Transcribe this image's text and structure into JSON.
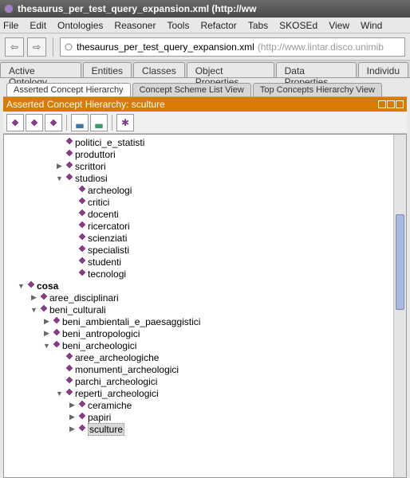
{
  "title": "thesaurus_per_test_query_expansion.xml (http://ww",
  "menu": [
    "File",
    "Edit",
    "Ontologies",
    "Reasoner",
    "Tools",
    "Refactor",
    "Tabs",
    "SKOSEd",
    "View",
    "Wind"
  ],
  "url": {
    "name": "thesaurus_per_test_query_expansion.xml",
    "dim": "(http://www.lintar.disco.unimib"
  },
  "tabs1": [
    "Active Ontology",
    "Entities",
    "Classes",
    "Object Properties",
    "Data Properties",
    "Individu"
  ],
  "tabs2": [
    "Asserted Concept Hierarchy",
    "Concept Scheme List View",
    "Top Concepts Hierarchy View"
  ],
  "panel_title": "Asserted Concept Hierarchy: sculture",
  "tree": [
    {
      "d": 4,
      "tw": "",
      "t": "politici_e_statisti"
    },
    {
      "d": 4,
      "tw": "",
      "t": "produttori"
    },
    {
      "d": 4,
      "tw": ">",
      "t": "scrittori"
    },
    {
      "d": 4,
      "tw": "v",
      "t": "studiosi"
    },
    {
      "d": 5,
      "tw": "",
      "t": "archeologi"
    },
    {
      "d": 5,
      "tw": "",
      "t": "critici"
    },
    {
      "d": 5,
      "tw": "",
      "t": "docenti"
    },
    {
      "d": 5,
      "tw": "",
      "t": "ricercatori"
    },
    {
      "d": 5,
      "tw": "",
      "t": "scienziati"
    },
    {
      "d": 5,
      "tw": "",
      "t": "specialisti"
    },
    {
      "d": 5,
      "tw": "",
      "t": "studenti"
    },
    {
      "d": 5,
      "tw": "",
      "t": "tecnologi"
    },
    {
      "d": 1,
      "tw": "v",
      "t": "cosa",
      "bold": true
    },
    {
      "d": 2,
      "tw": ">",
      "t": "aree_disciplinari"
    },
    {
      "d": 2,
      "tw": "v",
      "t": "beni_culturali"
    },
    {
      "d": 3,
      "tw": ">",
      "t": "beni_ambientali_e_paesaggistici"
    },
    {
      "d": 3,
      "tw": ">",
      "t": "beni_antropologici"
    },
    {
      "d": 3,
      "tw": "v",
      "t": "beni_archeologici"
    },
    {
      "d": 4,
      "tw": "",
      "t": "aree_archeologiche"
    },
    {
      "d": 4,
      "tw": "",
      "t": "monumenti_archeologici"
    },
    {
      "d": 4,
      "tw": "",
      "t": "parchi_archeologici"
    },
    {
      "d": 4,
      "tw": "v",
      "t": "reperti_archeologici"
    },
    {
      "d": 5,
      "tw": ">",
      "t": "ceramiche"
    },
    {
      "d": 5,
      "tw": ">",
      "t": "papiri"
    },
    {
      "d": 5,
      "tw": ">",
      "t": "sculture",
      "sel": true
    }
  ]
}
